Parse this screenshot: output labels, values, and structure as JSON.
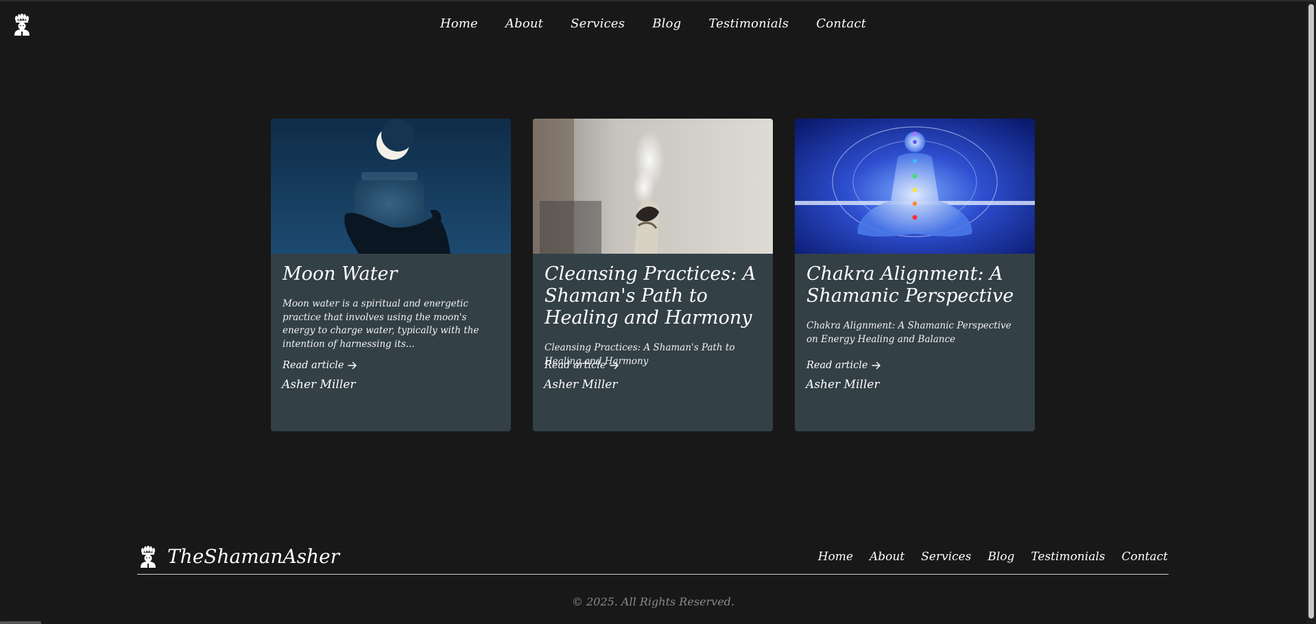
{
  "header": {
    "logo": "shaman-logo-icon",
    "nav": [
      "Home",
      "About",
      "Services",
      "Blog",
      "Testimonials",
      "Contact"
    ]
  },
  "cards": [
    {
      "title": "Moon Water",
      "excerpt": "Moon water is a spiritual and energetic practice that involves using the moon's energy to charge water, typically with the intention of harnessing its...",
      "read_label": "Read article",
      "author": "Asher Miller"
    },
    {
      "title": "Cleansing Practices: A Shaman's Path to Healing and Harmony",
      "excerpt": "Cleansing Practices: A Shaman's Path to Healing and Harmony",
      "read_label": "Read article",
      "author": "Asher Miller"
    },
    {
      "title": "Chakra Alignment: A Shamanic Perspective",
      "excerpt": "Chakra Alignment: A Shamanic Perspective on Energy Healing and Balance",
      "read_label": "Read article",
      "author": "Asher Miller"
    }
  ],
  "footer": {
    "brand": "TheShamanAsher",
    "nav": [
      "Home",
      "About",
      "Services",
      "Blog",
      "Testimonials",
      "Contact"
    ],
    "copyright": "© 2025. All Rights Reserved."
  },
  "colors": {
    "background": "#181818",
    "card": "#334046",
    "text": "#ffffff",
    "muted": "#8a8a8a"
  }
}
